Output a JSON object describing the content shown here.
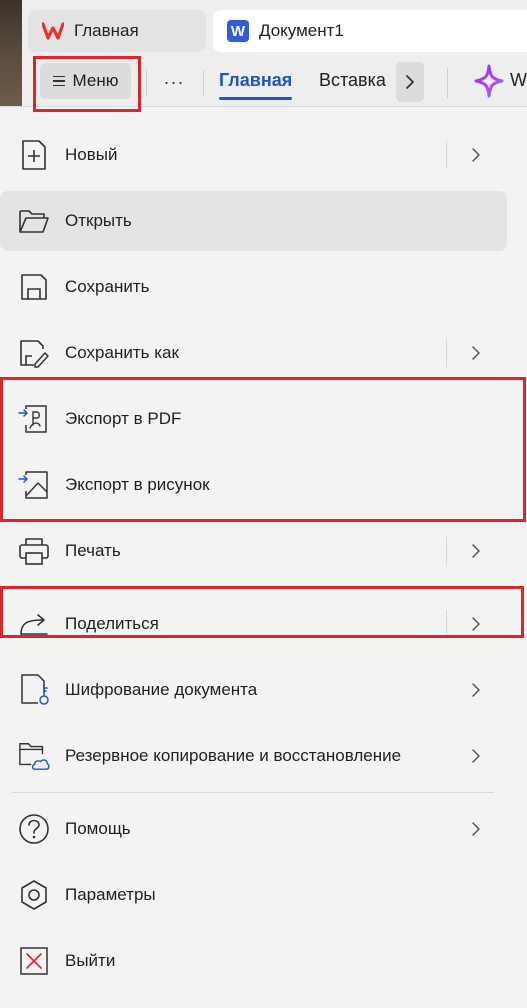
{
  "tabs": {
    "home_label": "Главная",
    "doc_logo": "W",
    "doc_label": "Документ1"
  },
  "toolbar": {
    "menu_label": "Меню",
    "more_label": "···",
    "ribbon_tabs": [
      "Главная",
      "Вставка"
    ],
    "ai_label": "W"
  },
  "menu": {
    "items": [
      {
        "label": "Новый",
        "icon": "new-document-icon",
        "submenu": true
      },
      {
        "label": "Открыть",
        "icon": "folder-open-icon",
        "submenu": false
      },
      {
        "label": "Сохранить",
        "icon": "save-icon",
        "submenu": false
      },
      {
        "label": "Сохранить как",
        "icon": "save-as-icon",
        "submenu": true
      },
      {
        "label": "Экспорт в PDF",
        "icon": "export-pdf-icon",
        "submenu": false
      },
      {
        "label": "Экспорт в рисунок",
        "icon": "export-image-icon",
        "submenu": false
      },
      {
        "label": "Печать",
        "icon": "printer-icon",
        "submenu": true
      },
      {
        "label": "Поделиться",
        "icon": "share-icon",
        "submenu": true
      },
      {
        "label": "Шифрование документа",
        "icon": "encrypt-document-icon",
        "submenu": true
      },
      {
        "label": "Резервное копирование и восстановление",
        "icon": "backup-icon",
        "submenu": true
      },
      {
        "label": "Помощь",
        "icon": "help-icon",
        "submenu": true
      },
      {
        "label": "Параметры",
        "icon": "settings-icon",
        "submenu": false
      },
      {
        "label": "Выйти",
        "icon": "exit-icon",
        "submenu": false
      }
    ]
  },
  "colors": {
    "accent": "#1e56c8",
    "highlight_box": "#e0242c",
    "wps_brand": "#e8312f",
    "word_brand": "#2f5fd8"
  }
}
